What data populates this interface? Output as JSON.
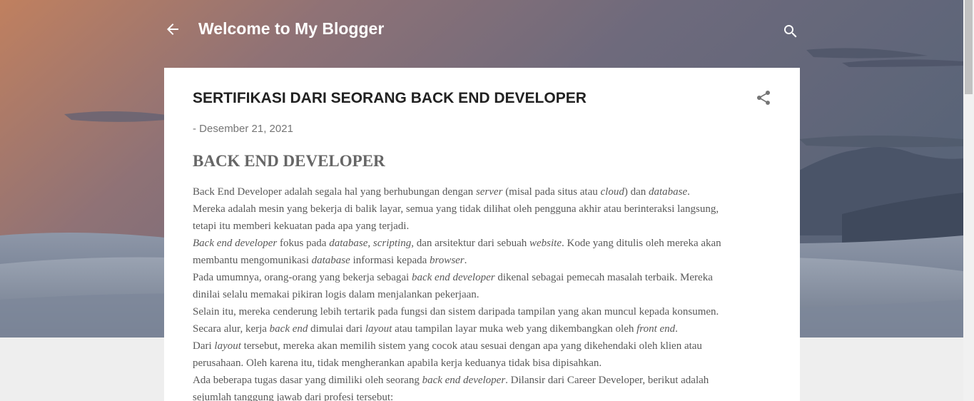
{
  "header": {
    "blog_title": "Welcome to My Blogger",
    "back_icon": "arrow-left-icon",
    "search_icon": "search-icon"
  },
  "post": {
    "title": "SERTIFIKASI DARI SEORANG BACK END DEVELOPER",
    "date": "Desember 21, 2021",
    "date_prefix": "- ",
    "share_icon": "share-icon",
    "section_heading": "BACK END DEVELOPER",
    "body": {
      "l1": [
        "Back End Developer adalah segala hal yang berhubungan dengan ",
        "server",
        " (misal pada situs atau ",
        "cloud",
        ") dan ",
        "database",
        "."
      ],
      "l2": [
        "Mereka adalah mesin yang bekerja di balik layar, semua yang tidak dilihat oleh pengguna akhir atau berinteraksi langsung,"
      ],
      "l3": [
        "tetapi itu memberi kekuatan pada apa yang terjadi."
      ],
      "l4": [
        "Back end developer",
        " fokus pada ",
        "database",
        ", ",
        "scripting",
        ", dan arsitektur dari sebuah ",
        "website",
        ". Kode yang ditulis oleh mereka akan"
      ],
      "l5": [
        "membantu mengomunikasi ",
        "database",
        " informasi kepada ",
        "browser",
        "."
      ],
      "l6": [
        "Pada umumnya, orang-orang yang bekerja sebagai ",
        "back end developer",
        " dikenal sebagai pemecah masalah terbaik. Mereka"
      ],
      "l7": [
        "dinilai selalu memakai pikiran logis dalam menjalankan pekerjaan."
      ],
      "l8": [
        "Selain itu, mereka cenderung lebih tertarik pada fungsi dan sistem daripada tampilan yang akan muncul kepada konsumen."
      ],
      "l9": [
        "Secara alur, kerja ",
        "back end",
        " dimulai dari ",
        "layout",
        " atau tampilan layar muka web yang dikembangkan oleh ",
        "front end",
        "."
      ],
      "l10": [
        "Dari ",
        "layout",
        " tersebut, mereka akan memilih sistem yang cocok atau sesuai dengan apa yang dikehendaki oleh klien atau"
      ],
      "l11": [
        "perusahaan. Oleh karena itu, tidak mengherankan apabila kerja keduanya tidak bisa dipisahkan."
      ],
      "l12": [
        "Ada beberapa tugas dasar yang dimiliki oleh seorang ",
        "back end developer",
        ". Dilansir dari Career Developer, berikut adalah"
      ],
      "l13": [
        "sejumlah tanggung jawab dari profesi tersebut:"
      ]
    }
  },
  "colors": {
    "title_text": "#212121",
    "date_text": "#757575",
    "body_text": "#595959",
    "header_text": "#ffffff"
  }
}
